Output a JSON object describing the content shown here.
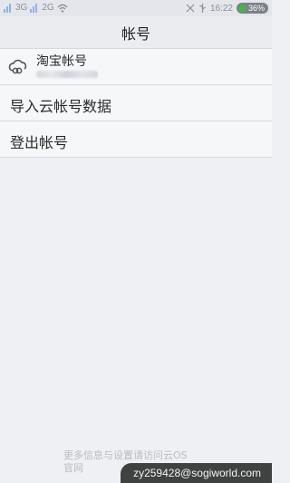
{
  "status_bar": {
    "sim1": "3G",
    "sim2": "2G",
    "time": "16:22",
    "battery": "36%"
  },
  "header": {
    "title": "帐号"
  },
  "account": {
    "name": "淘宝帐号",
    "icon": "cloud-link-icon"
  },
  "menu": {
    "import_label": "导入云帐号数据",
    "logout_label": "登出帐号"
  },
  "footer": {
    "line1": "更多信息与设置请访问云OS",
    "line2": "官网"
  },
  "watermark": "zy259428@sogiworld.com"
}
